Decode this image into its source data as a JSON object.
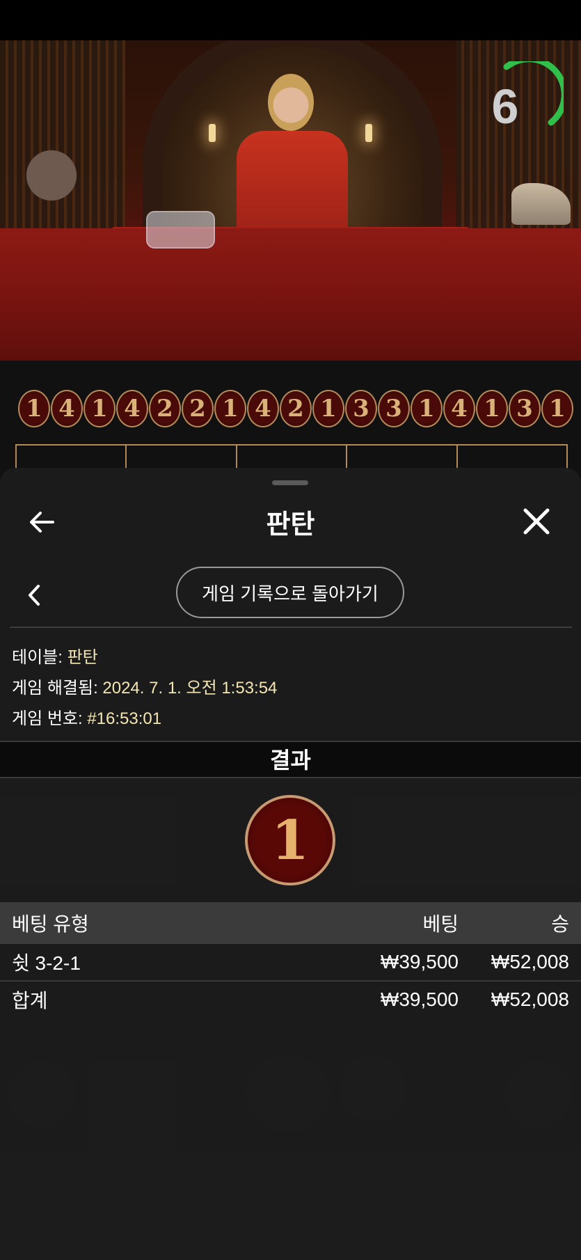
{
  "timer": {
    "seconds": "6",
    "progress": 0.3
  },
  "road": [
    "1",
    "4",
    "1",
    "4",
    "2",
    "2",
    "1",
    "4",
    "2",
    "1",
    "3",
    "3",
    "1",
    "4",
    "1",
    "3",
    "1"
  ],
  "bet_grid_top": [
    "",
    "",
    "",
    "",
    ""
  ],
  "sheet": {
    "title": "판탄",
    "back_to_history": "게임 기록으로 돌아가기",
    "info": {
      "table_label": "테이블: ",
      "table_value": "판탄",
      "resolved_label": "게임 해결됨: ",
      "resolved_value": "2024. 7. 1. 오전 1:53:54",
      "game_no_label": "게임 번호: ",
      "game_no_value": "#16:53:01"
    },
    "result_label": "결과",
    "result_value": "1",
    "table": {
      "headers": {
        "type": "베팅 유형",
        "bet": "베팅",
        "win": "승"
      },
      "rows": [
        {
          "type": "쉿 3-2-1",
          "bet": "₩39,500",
          "win": "₩52,008"
        }
      ],
      "total": {
        "type": "합계",
        "bet": "₩39,500",
        "win": "₩52,008"
      }
    }
  },
  "colors": {
    "accent_gold": "#c79a72",
    "timer_green": "#2fbf4a",
    "result_red": "#5a0806"
  }
}
